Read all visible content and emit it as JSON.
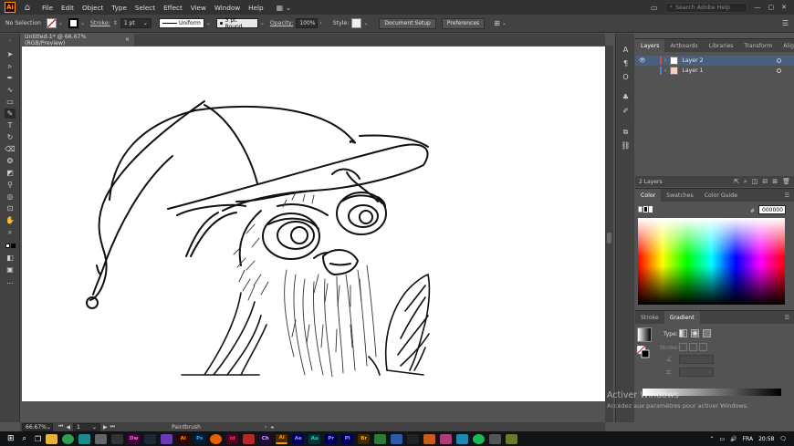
{
  "app": {
    "logo": "Ai",
    "search_placeholder": "Search Adobe Help"
  },
  "menu": [
    "File",
    "Edit",
    "Object",
    "Type",
    "Select",
    "Effect",
    "View",
    "Window",
    "Help"
  ],
  "controlbar": {
    "selection": "No Selection",
    "stroke_label": "Stroke:",
    "stroke_value": "1 pt",
    "profile": "Uniform",
    "brush": "3 pt. Round",
    "opacity_label": "Opacity:",
    "opacity_value": "100%",
    "style_label": "Style:",
    "doc_setup": "Document Setup",
    "preferences": "Preferences"
  },
  "document": {
    "tab_title": "Untitled-1* @ 66.67% (RGB/Preview)",
    "close": "×"
  },
  "status": {
    "zoom": "66.67%",
    "page": "1",
    "tool": "Paintbrush"
  },
  "layers_panel": {
    "tabs": [
      "Layers",
      "Artboards",
      "Libraries",
      "Transform",
      "Align"
    ],
    "layers": [
      {
        "name": "Layer 2",
        "color": "#e0463c",
        "selected": true
      },
      {
        "name": "Layer 1",
        "color": "#4f7dd9",
        "selected": false
      }
    ],
    "count": "2 Layers"
  },
  "color_panel": {
    "tabs": [
      "Color",
      "Swatches",
      "Color Guide"
    ],
    "hex_prefix": "#",
    "hex": "000000"
  },
  "gradient_panel": {
    "tabs": [
      "Stroke",
      "Gradient"
    ],
    "type_label": "Type:",
    "stroke_label": "Stroke:"
  },
  "watermark": {
    "title": "Activer Windows",
    "subtitle": "Accédez aux paramètres pour activer Windows."
  },
  "taskbar": {
    "apps": [
      "Dw",
      "Ai",
      "Ps",
      "Id",
      "Au",
      "Ae",
      "Pr",
      "Pl",
      "Ch",
      "Br"
    ],
    "lang": "FRA",
    "time": "20:58"
  }
}
